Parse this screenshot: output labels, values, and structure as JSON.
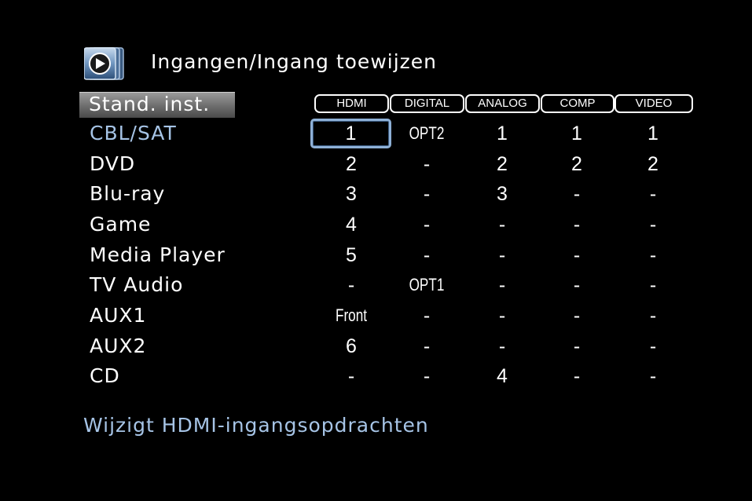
{
  "header": {
    "title": "Ingangen/Ingang toewijzen"
  },
  "default_button": {
    "label": "Stand. inst."
  },
  "columns": [
    "HDMI",
    "DIGITAL",
    "ANALOG",
    "COMP",
    "VIDEO"
  ],
  "rows": [
    {
      "source": "CBL/SAT",
      "values": [
        "1",
        "OPT2",
        "1",
        "1",
        "1"
      ]
    },
    {
      "source": "DVD",
      "values": [
        "2",
        "-",
        "2",
        "2",
        "2"
      ]
    },
    {
      "source": "Blu-ray",
      "values": [
        "3",
        "-",
        "3",
        "-",
        "-"
      ]
    },
    {
      "source": "Game",
      "values": [
        "4",
        "-",
        "-",
        "-",
        "-"
      ]
    },
    {
      "source": "Media Player",
      "values": [
        "5",
        "-",
        "-",
        "-",
        "-"
      ]
    },
    {
      "source": "TV Audio",
      "values": [
        "-",
        "OPT1",
        "-",
        "-",
        "-"
      ]
    },
    {
      "source": "AUX1",
      "values": [
        "Front",
        "-",
        "-",
        "-",
        "-"
      ]
    },
    {
      "source": "AUX2",
      "values": [
        "6",
        "-",
        "-",
        "-",
        "-"
      ]
    },
    {
      "source": "CD",
      "values": [
        "-",
        "-",
        "4",
        "-",
        "-"
      ]
    }
  ],
  "status": {
    "text": "Wijzigt HDMI-ingangsopdrachten"
  },
  "colors": {
    "highlight": "#a6c4e6",
    "background": "#000000"
  },
  "icons": {
    "menu": "menu-arrow-icon"
  }
}
